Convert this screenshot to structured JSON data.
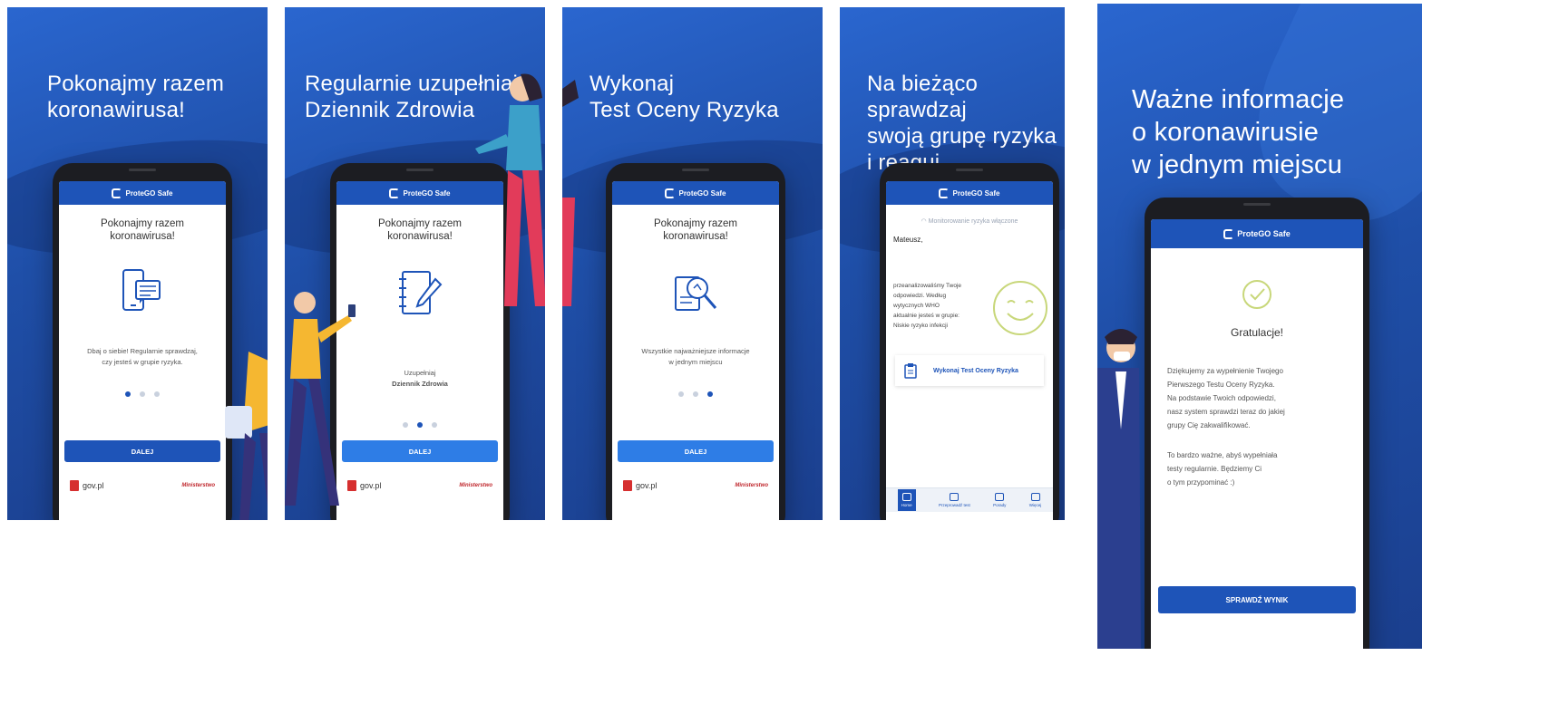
{
  "colors": {
    "panel_blue": "#1f4fa8",
    "accent_blue": "#1e54b8",
    "button_light_blue": "#2e7de6",
    "gov_red": "#d62f2f",
    "smiley_color": "#c8d77a"
  },
  "app": {
    "name": "ProteGO Safe"
  },
  "panels": [
    {
      "headline": "Pokonajmy razem\nkoronawirusa!",
      "screen_title": "Pokonajmy razem\nkoronawirusa!",
      "icon": "phone-chat-icon",
      "screen_body": "Dbaj o siebie! Regularnie sprawdzaj,\nczy jesteś w grupie ryzyka.",
      "button": "DALEJ",
      "gov": "gov.pl",
      "partner": "Ministerstwo"
    },
    {
      "headline": "Regularnie uzupełniaj\nDziennik Zdrowia",
      "screen_title": "Pokonajmy razem\nkoronawirusa!",
      "icon": "notebook-pen-icon",
      "screen_body_prefix": "Uzupełniaj",
      "screen_body_bold": "Dziennik Zdrowia",
      "button": "DALEJ",
      "gov": "gov.pl",
      "partner": "Ministerstwo"
    },
    {
      "headline": "Wykonaj\nTest Oceny Ryzyka",
      "screen_title": "Pokonajmy razem\nkoronawirusa!",
      "icon": "document-magnifier-icon",
      "screen_body": "Wszystkie najważniejsze informacje\nw jednym miejscu",
      "button": "DALEJ",
      "gov": "gov.pl",
      "partner": "Ministerstwo"
    },
    {
      "headline": "Na bieżąco sprawdzaj\nswoją grupę ryzyka\ni reaguj",
      "status": "Monitorowanie ryzyka włączone",
      "name": "Mateusz,",
      "text": "przeanalizowaliśmy Twoje\nodpowiedzi. Według\nwytycznych WHO\naktualnie jesteś w grupie:\nNiskie ryzyko infekcji",
      "test_button": "Wykonaj Test Oceny Ryzyka",
      "nav": [
        "Home",
        "Przeprowadź test",
        "Porady",
        "Więcej"
      ]
    },
    {
      "headline": "Ważne informacje\no koronawirusie\nw jednym miejscu",
      "title": "Gratulacje!",
      "body": "Dziękujemy za wypełnienie Twojego\nPierwszego Testu Oceny Ryzyka.\nNa podstawie Twoich odpowiedzi,\nnasz system sprawdzi teraz do jakiej\ngrupy Cię zakwalifikować.",
      "body2": "To bardzo ważne, abyś wypełniała\ntesty regularnie. Będziemy Ci\no tym przypominać :)",
      "button": "SPRAWDŹ WYNIK"
    }
  ]
}
